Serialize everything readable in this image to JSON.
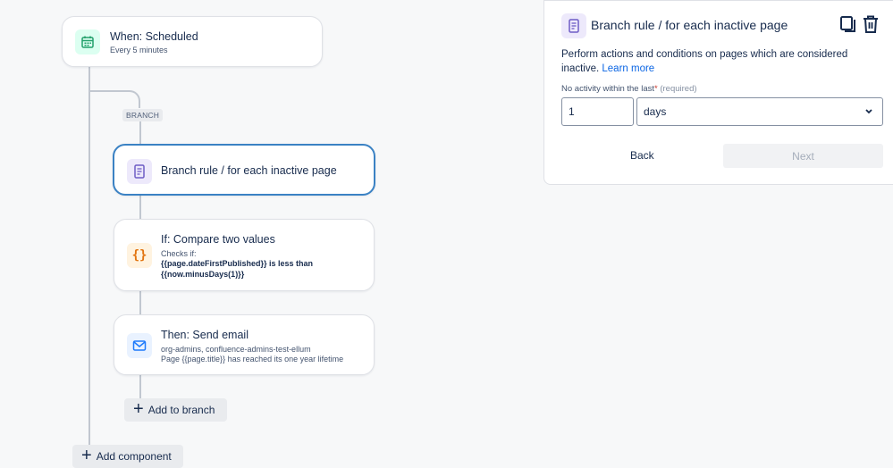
{
  "trigger": {
    "title": "When: Scheduled",
    "subtitle": "Every 5 minutes"
  },
  "branch": {
    "label": "BRANCH"
  },
  "branch_rule": {
    "title": "Branch rule / for each inactive page"
  },
  "condition": {
    "title": "If: Compare two values",
    "checks_label": "Checks if:",
    "expr_line1": "{{page.dateFirstPublished}} is less than",
    "expr_line2": "{{now.minusDays(1)}}"
  },
  "action": {
    "title": "Then: Send email",
    "line1": "org-admins, confluence-admins-test-ellum",
    "line2": "Page {{page.title}} has reached its one year lifetime"
  },
  "add_to_branch": "Add to branch",
  "add_component": "Add component",
  "panel": {
    "title": "Branch rule / for each inactive page",
    "description": "Perform actions and conditions on pages which are considered inactive.",
    "learn_more": "Learn more",
    "field_label": "No activity within the last",
    "required_star": "*",
    "required_text": "(required)",
    "value": "1",
    "unit": "days",
    "back": "Back",
    "next": "Next"
  },
  "colors": {
    "accent_blue": "#3b82c4",
    "calendar_green": "#22a06b",
    "page_purple": "#6e5dc6",
    "braces_orange": "#e2740f",
    "email_blue": "#1d7afc"
  },
  "icons": [
    "calendar-icon",
    "page-icon",
    "braces-icon",
    "email-icon",
    "copy-icon",
    "trash-icon",
    "plus-icon",
    "chevron-down-icon"
  ]
}
